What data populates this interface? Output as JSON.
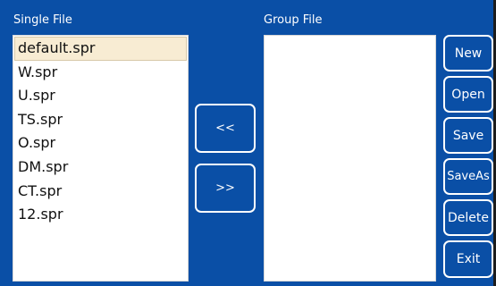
{
  "single_file": {
    "label": "Single File",
    "items": [
      {
        "name": "default.spr"
      },
      {
        "name": "W.spr"
      },
      {
        "name": "U.spr"
      },
      {
        "name": "TS.spr"
      },
      {
        "name": "O.spr"
      },
      {
        "name": "DM.spr"
      },
      {
        "name": "CT.spr"
      },
      {
        "name": "12.spr"
      }
    ]
  },
  "group_file": {
    "label": "Group File",
    "items": []
  },
  "transfer": {
    "move_left_label": "<<",
    "move_right_label": ">>"
  },
  "actions": {
    "new": "New",
    "open": "Open",
    "save": "Save",
    "save_as": "SaveAs",
    "delete": "Delete",
    "exit": "Exit"
  },
  "colors": {
    "panel_background": "#0a4fa6",
    "selection_background": "#f8ecd3",
    "button_border": "#ffffff"
  }
}
